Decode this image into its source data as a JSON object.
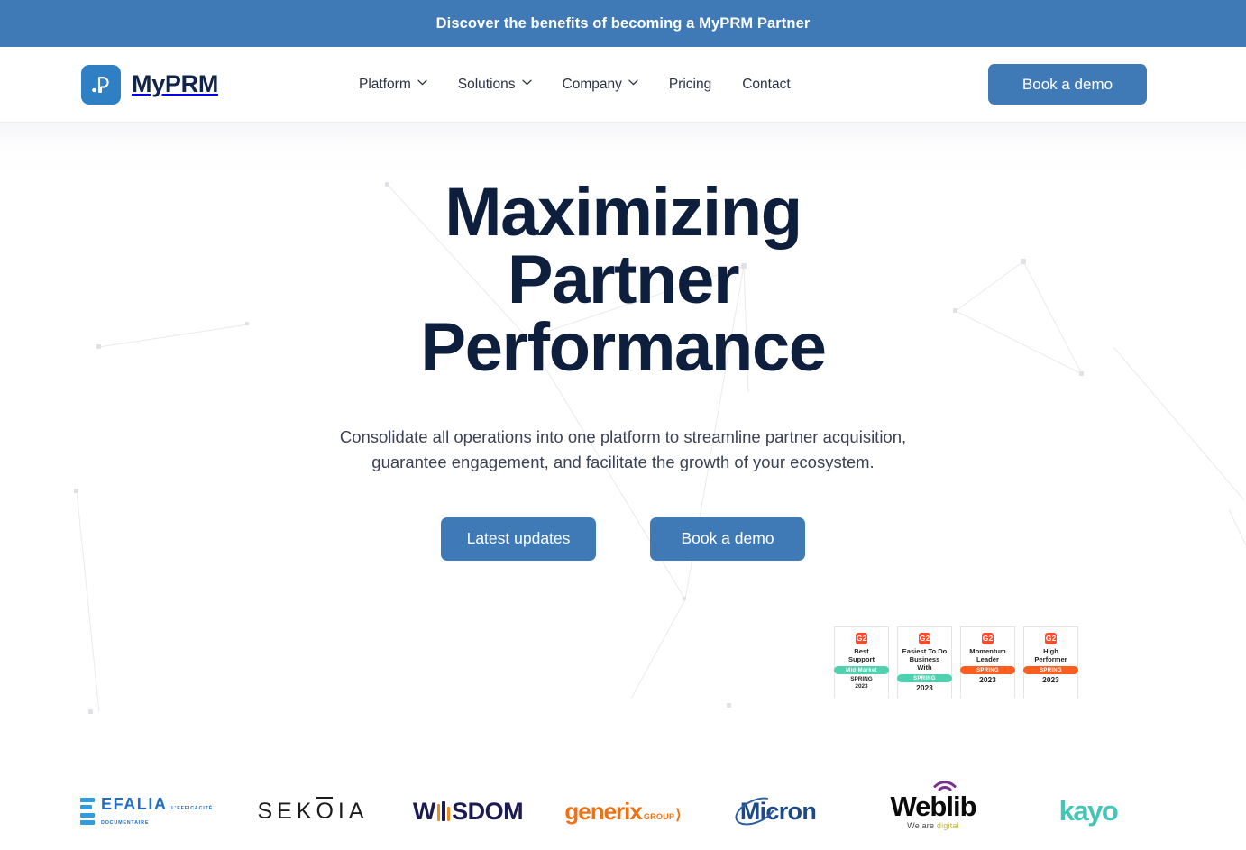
{
  "announcement": {
    "text": "Discover the benefits of becoming a MyPRM Partner"
  },
  "header": {
    "brand_name": "MyPRM",
    "brand_mark": ".p",
    "nav": [
      {
        "label": "Platform",
        "has_dropdown": true
      },
      {
        "label": "Solutions",
        "has_dropdown": true
      },
      {
        "label": "Company",
        "has_dropdown": true
      },
      {
        "label": "Pricing",
        "has_dropdown": false
      },
      {
        "label": "Contact",
        "has_dropdown": false
      }
    ],
    "cta_label": "Book a demo"
  },
  "hero": {
    "title_line1": "Maximizing",
    "title_line2": "Partner",
    "title_line3": "Performance",
    "subtitle": "Consolidate all operations into one platform to streamline partner acquisition, guarantee engagement, and facilitate the growth of your ecosystem.",
    "primary_cta": "Latest updates",
    "secondary_cta": "Book a demo"
  },
  "badges": [
    {
      "provider": "G2",
      "title_line1": "Best",
      "title_line2": "Support",
      "band": "Mid-Market",
      "band_color": "#4fd1b0",
      "season": "SPRING",
      "year": "2023",
      "layout": "band-then-season-year"
    },
    {
      "provider": "G2",
      "title_line1": "Easiest To Do",
      "title_line2": "Business With",
      "band": "SPRING",
      "band_color": "#4fd1b0",
      "season": "",
      "year": "2023",
      "layout": "band-then-year"
    },
    {
      "provider": "G2",
      "title_line1": "Momentum",
      "title_line2": "Leader",
      "band": "SPRING",
      "band_color": "#fd5e1f",
      "season": "",
      "year": "2023",
      "layout": "band-then-year"
    },
    {
      "provider": "G2",
      "title_line1": "High",
      "title_line2": "Performer",
      "band": "SPRING",
      "band_color": "#fd5e1f",
      "season": "",
      "year": "2023",
      "layout": "band-then-year"
    }
  ],
  "client_logos": [
    {
      "name": "EFALIA",
      "tagline": "L'EFFICACITÉ DOCUMENTAIRE",
      "color": "#1f6fc4"
    },
    {
      "name": "SEKOIA",
      "tagline": "",
      "color": "#1c1c1c"
    },
    {
      "name": "WIISDOM",
      "tagline": "",
      "color": "#1b1b52"
    },
    {
      "name": "generix",
      "tagline": "GROUP",
      "color": "#f07114"
    },
    {
      "name": "Micron",
      "tagline": "",
      "color": "#1c4a88"
    },
    {
      "name": "Weblib",
      "tagline": "We are digital",
      "color": "#0a0a0a"
    },
    {
      "name": "kayo",
      "tagline": "",
      "color": "#45c4b8"
    }
  ],
  "theme": {
    "banner_blue": "#3f7ab7",
    "button_blue": "#3f7ab7",
    "logo_blue": "#2f7fc4",
    "heading_navy": "#0d1f3c",
    "body_text": "#3b4257"
  }
}
